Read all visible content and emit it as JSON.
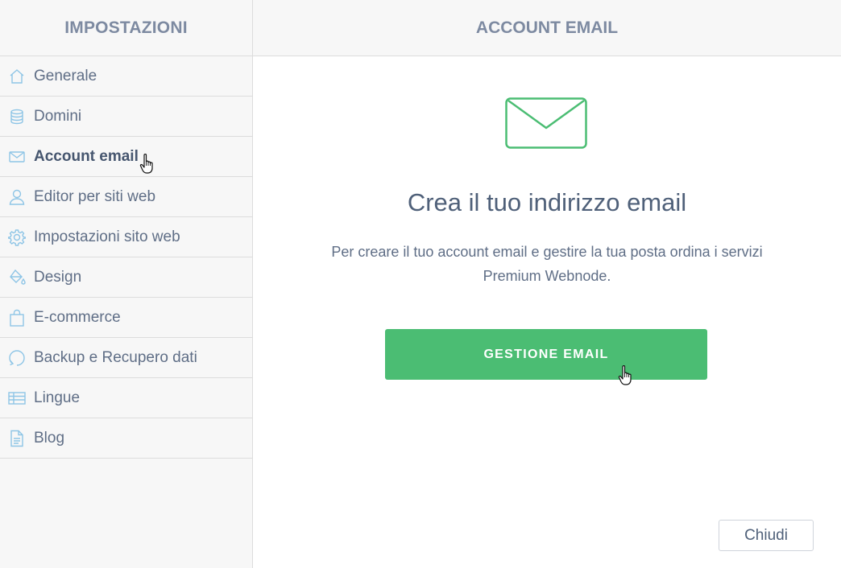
{
  "sidebar": {
    "title": "IMPOSTAZIONI",
    "items": [
      {
        "label": "Generale",
        "icon": "home-icon"
      },
      {
        "label": "Domini",
        "icon": "database-icon"
      },
      {
        "label": "Account email",
        "icon": "envelope-icon",
        "active": true
      },
      {
        "label": "Editor per siti web",
        "icon": "user-icon"
      },
      {
        "label": "Impostazioni sito web",
        "icon": "gear-icon"
      },
      {
        "label": "Design",
        "icon": "paint-bucket-icon"
      },
      {
        "label": "E-commerce",
        "icon": "shopping-bag-icon"
      },
      {
        "label": "Backup e Recupero dati",
        "icon": "restore-icon"
      },
      {
        "label": "Lingue",
        "icon": "language-list-icon"
      },
      {
        "label": "Blog",
        "icon": "document-icon"
      }
    ]
  },
  "main": {
    "title": "ACCOUNT EMAIL",
    "headline": "Crea il tuo indirizzo email",
    "description_line1": "Per creare il tuo account email e gestire la tua posta ordina i servizi",
    "description_line2": "Premium Webnode.",
    "primary_button": "GESTIONE EMAIL",
    "close_button": "Chiudi"
  },
  "colors": {
    "accent_green": "#4bbd73",
    "icon_blue": "#8ec5e6",
    "text": "#5f6e86",
    "sidebar_bg": "#f7f7f7"
  }
}
